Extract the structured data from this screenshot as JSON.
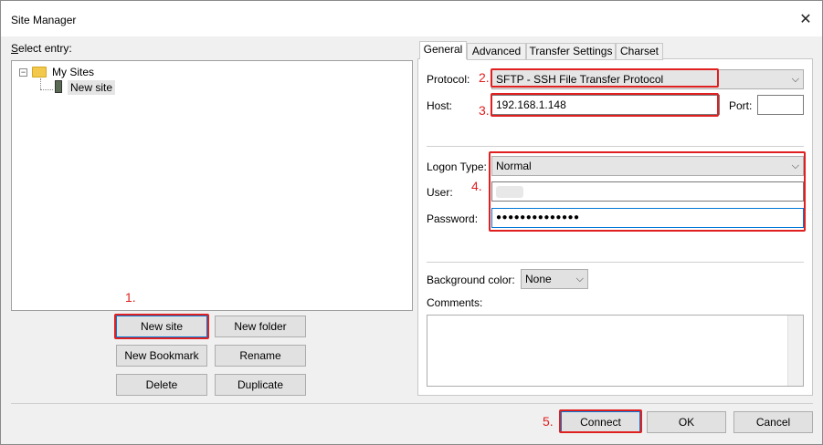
{
  "window": {
    "title": "Site Manager",
    "close_glyph": "✕"
  },
  "left": {
    "select_entry_label": "Select entry:",
    "tree": {
      "root": "My Sites",
      "root_expander": "−",
      "child": "New site"
    },
    "buttons": {
      "new_site": "New site",
      "new_folder": "New folder",
      "new_bookmark": "New Bookmark",
      "rename": "Rename",
      "delete": "Delete",
      "duplicate": "Duplicate"
    }
  },
  "tabs": [
    "General",
    "Advanced",
    "Transfer Settings",
    "Charset"
  ],
  "general": {
    "protocol_label": "Protocol:",
    "protocol_value": "SFTP - SSH File Transfer Protocol",
    "host_label": "Host:",
    "host_value": "192.168.1.148",
    "port_label": "Port:",
    "port_value": "",
    "logon_type_label": "Logon Type:",
    "logon_type_value": "Normal",
    "user_label": "User:",
    "user_value": "",
    "password_label": "Password:",
    "password_value": "●●●●●●●●●●●●●●",
    "bg_color_label": "Background color:",
    "bg_color_value": "None",
    "comments_label": "Comments:",
    "comments_value": ""
  },
  "footer": {
    "connect": "Connect",
    "ok": "OK",
    "cancel": "Cancel"
  },
  "annotations": {
    "n1": "1.",
    "n2": "2.",
    "n3": "3.",
    "n4": "4.",
    "n5": "5."
  },
  "icons": {
    "chevron": "⌵",
    "folder": "folder-icon",
    "server": "server-icon"
  },
  "colors": {
    "annotation": "#e02020",
    "focus": "#0078d7"
  }
}
